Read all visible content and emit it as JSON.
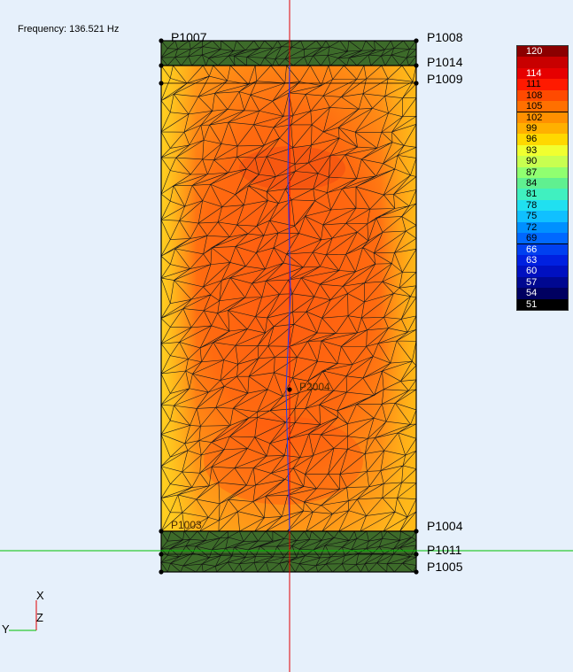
{
  "frequency_label": "Frequency: 136.521 Hz",
  "points": [
    {
      "id": "p1007",
      "label": "P1007"
    },
    {
      "id": "p1008",
      "label": "P1008"
    },
    {
      "id": "p1014",
      "label": "P1014"
    },
    {
      "id": "p1009",
      "label": "P1009"
    },
    {
      "id": "p1004",
      "label": "P1004"
    },
    {
      "id": "p1011",
      "label": "P1011"
    },
    {
      "id": "p1005",
      "label": "P1005"
    },
    {
      "id": "p1003",
      "label": "P1003"
    },
    {
      "id": "p2004",
      "label": "P2004"
    }
  ],
  "legend": {
    "values": [
      "120",
      "",
      "114",
      "111",
      "108",
      "105",
      "102",
      "99",
      "96",
      "93",
      "90",
      "87",
      "84",
      "81",
      "78",
      "75",
      "72",
      "69",
      "66",
      "63",
      "60",
      "57",
      "54",
      "51"
    ],
    "colors": [
      "#8b0000",
      "#c80000",
      "#e60000",
      "#ff1a00",
      "#ff4a00",
      "#ff7000",
      "#ff9000",
      "#ffb000",
      "#ffd800",
      "#f0ff30",
      "#c8ff50",
      "#90ff70",
      "#60f090",
      "#40f0c0",
      "#20e0f0",
      "#10c0ff",
      "#0090ff",
      "#0068ff",
      "#0040f0",
      "#0020e0",
      "#0010c0",
      "#000890",
      "#000060",
      "#000000"
    ]
  },
  "axes": {
    "x": "X",
    "z": "Z",
    "y": "Y"
  }
}
